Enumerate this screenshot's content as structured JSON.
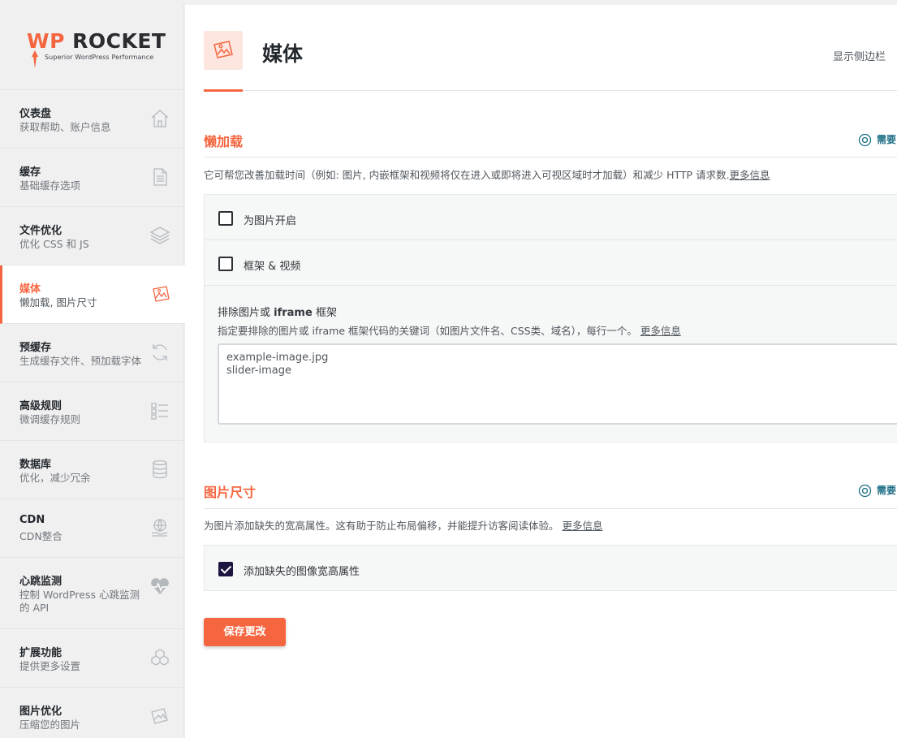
{
  "brand": {
    "wp": "WP",
    "rocket": "ROCKET",
    "tagline": "Superior WordPress Performance",
    "accent": "#f56640"
  },
  "sidebar": {
    "items": [
      {
        "title": "仪表盘",
        "subtitle": "获取帮助、账户信息",
        "icon": "home-icon"
      },
      {
        "title": "缓存",
        "subtitle": "基础缓存选项",
        "icon": "document-icon"
      },
      {
        "title": "文件优化",
        "subtitle": "优化 CSS 和 JS",
        "icon": "layers-icon"
      },
      {
        "title": "媒体",
        "subtitle": "懒加载, 图片尺寸",
        "icon": "images-icon"
      },
      {
        "title": "预缓存",
        "subtitle": "生成缓存文件、预加载字体",
        "icon": "refresh-icon"
      },
      {
        "title": "高级规则",
        "subtitle": "微调缓存规则",
        "icon": "checklist-icon"
      },
      {
        "title": "数据库",
        "subtitle": "优化，减少冗余",
        "icon": "database-icon"
      },
      {
        "title": "CDN",
        "subtitle": "CDN整合",
        "icon": "globe-hand-icon"
      },
      {
        "title": "心跳监测",
        "subtitle": "控制 WordPress 心跳监测的 API",
        "icon": "heartbeat-icon"
      },
      {
        "title": "扩展功能",
        "subtitle": "提供更多设置",
        "icon": "cubes-icon"
      },
      {
        "title": "图片优化",
        "subtitle": "压缩您的图片",
        "icon": "image-compress-icon"
      }
    ]
  },
  "header": {
    "title": "媒体",
    "toggle": "显示侧边栏"
  },
  "lazyload": {
    "title": "懒加载",
    "help": "需要",
    "desc": "它可帮您改善加载时间（例如: 图片, 内嵌框架和视频将仅在进入或即将进入可视区域时才加载）和减少 HTTP 请求数.",
    "more": "更多信息",
    "images_label": "为图片开启",
    "iframes_label": "框架 & 视频",
    "exclude_title_a": "排除图片或 ",
    "exclude_title_b": "iframe",
    "exclude_title_c": " 框架",
    "exclude_desc": "指定要排除的图片或 iframe 框架代码的关键词（如图片文件名、CSS类、域名），每行一个。",
    "exclude_more": "更多信息",
    "exclude_value": "example-image.jpg\nslider-image"
  },
  "dimensions": {
    "title": "图片尺寸",
    "help": "需要",
    "desc": "为图片添加缺失的宽高属性。这有助于防止布局偏移，并能提升访客阅读体验。",
    "more": "更多信息",
    "add_label": "添加缺失的图像宽高属性"
  },
  "save_label": "保存更改"
}
